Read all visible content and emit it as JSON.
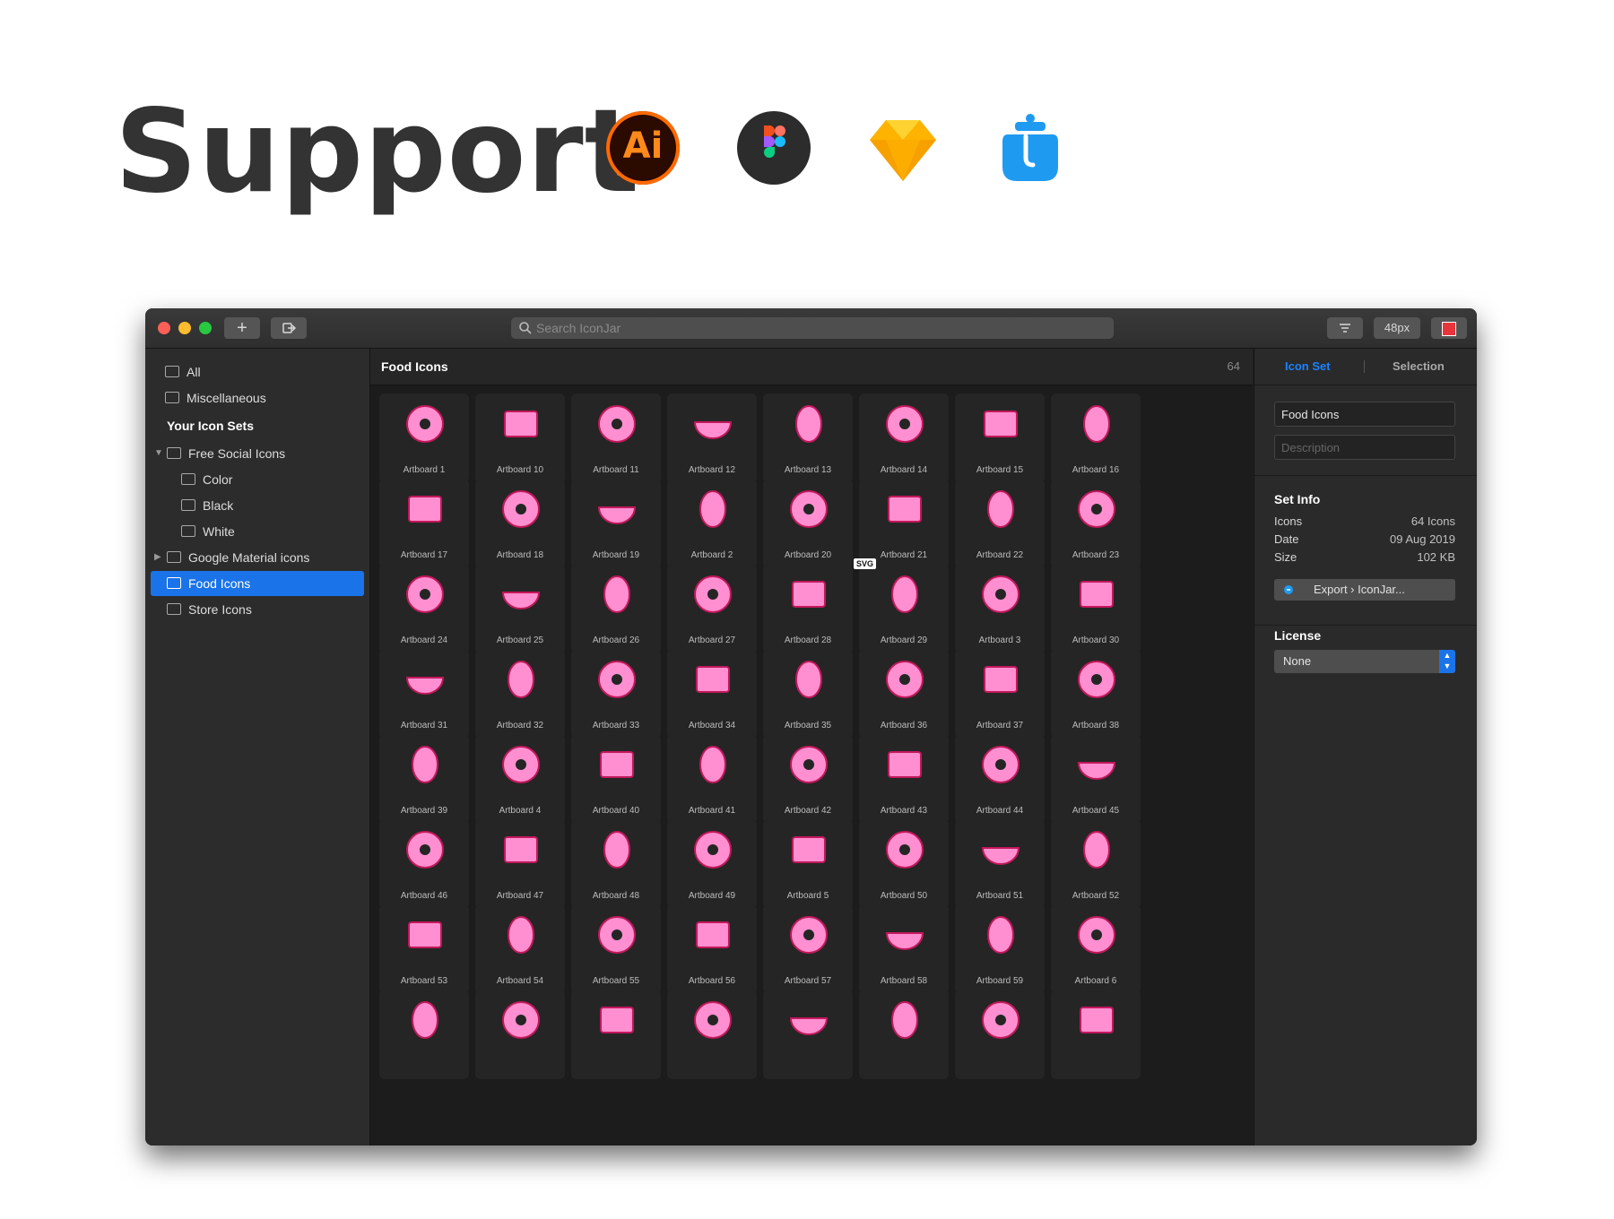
{
  "headline": "Support",
  "logos": {
    "illustrator": {
      "text": "Ai",
      "color": "#ff6a00"
    },
    "figma": {
      "colors": [
        "#f24e1e",
        "#ff7262",
        "#a259ff",
        "#1abcfe",
        "#0acf83"
      ]
    },
    "sketch": {
      "color": "#f7b500"
    },
    "iconjar": {
      "color": "#1e9bf0"
    }
  },
  "window": {
    "toolbar": {
      "add_icon": "+",
      "search_placeholder": "Search IconJar",
      "size_label": "48px"
    },
    "sidebar": {
      "items": [
        {
          "label": "All"
        },
        {
          "label": "Miscellaneous"
        }
      ],
      "section_title": "Your Icon Sets",
      "sets": [
        {
          "label": "Free Social Icons",
          "expanded": true,
          "children": [
            "Color",
            "Black",
            "White"
          ]
        },
        {
          "label": "Google Material icons",
          "expanded": false
        },
        {
          "label": "Food Icons",
          "selected": true
        },
        {
          "label": "Store Icons"
        }
      ]
    },
    "main": {
      "title": "Food Icons",
      "count": "64",
      "svg_badge": "SVG",
      "icon_color": "#ff8fd0",
      "tiles": [
        "Artboard 1",
        "Artboard 10",
        "Artboard 11",
        "Artboard 12",
        "Artboard 13",
        "Artboard 14",
        "Artboard 15",
        "Artboard 16",
        "Artboard 17",
        "Artboard 18",
        "Artboard 19",
        "Artboard 2",
        "Artboard 20",
        "Artboard 21",
        "Artboard 22",
        "Artboard 23",
        "Artboard 24",
        "Artboard 25",
        "Artboard 26",
        "Artboard 27",
        "Artboard 28",
        "Artboard 29",
        "Artboard 3",
        "Artboard 30",
        "Artboard 31",
        "Artboard 32",
        "Artboard 33",
        "Artboard 34",
        "Artboard 35",
        "Artboard 36",
        "Artboard 37",
        "Artboard 38",
        "Artboard 39",
        "Artboard 4",
        "Artboard 40",
        "Artboard 41",
        "Artboard 42",
        "Artboard 43",
        "Artboard 44",
        "Artboard 45",
        "Artboard 46",
        "Artboard 47",
        "Artboard 48",
        "Artboard 49",
        "Artboard 5",
        "Artboard 50",
        "Artboard 51",
        "Artboard 52",
        "Artboard 53",
        "Artboard 54",
        "Artboard 55",
        "Artboard 56",
        "Artboard 57",
        "Artboard 58",
        "Artboard 59",
        "Artboard 6",
        "",
        "",
        "",
        "",
        "",
        "",
        "",
        ""
      ],
      "tile_icons": [
        "donut",
        "hotdog",
        "pizza",
        "bowl",
        "eggs",
        "grapes",
        "coffee-machine",
        "avocado",
        "bread-box",
        "pizza-slice",
        "rugby-bread",
        "popsicle",
        "plates",
        "ice-cream",
        "plate-fork",
        "toaster",
        "bottle",
        "pie",
        "watermelon",
        "beer",
        "chef-hat",
        "orange",
        "cloche",
        "cocktail",
        "stove-top",
        "grater",
        "bun",
        "cupcake",
        "oven",
        "cake",
        "cheese",
        "candy",
        "fries",
        "plate-spoon",
        "baguette",
        "citrus",
        "scale",
        "cooking-pot",
        "menu-book",
        "toast",
        "coffee-bean",
        "apple",
        "pot",
        "wine-glass",
        "burger",
        "pineapple",
        "skewer",
        "soup",
        "cup",
        "package",
        "bottles",
        "chicken-leg",
        "fruit-bowl",
        "fridge",
        "mushroom",
        "fish",
        "mug",
        "egg-cup",
        "ice-pop",
        "cherries",
        "cutting-board",
        "hamburger",
        "lollipop",
        "fried-egg"
      ]
    },
    "panel": {
      "tabs": [
        "Icon Set",
        "Selection"
      ],
      "name_value": "Food Icons",
      "description_placeholder": "Description",
      "set_info_title": "Set Info",
      "info": [
        {
          "label": "Icons",
          "value": "64 Icons"
        },
        {
          "label": "Date",
          "value": "09 Aug 2019"
        },
        {
          "label": "Size",
          "value": "102 KB"
        }
      ],
      "export_label": "Export › IconJar...",
      "license_title": "License",
      "license_value": "None"
    }
  }
}
